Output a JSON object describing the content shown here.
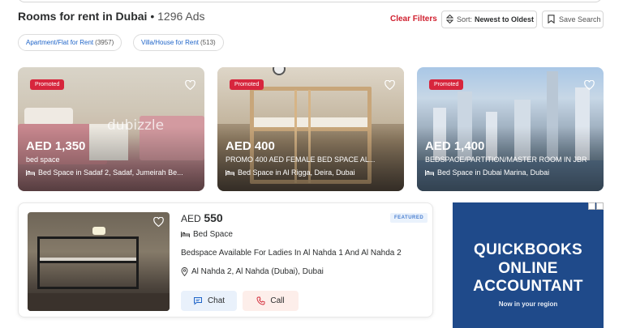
{
  "header": {
    "title": "Rooms for rent in Dubai",
    "separator": " • ",
    "ad_count": "1296 Ads",
    "clear_filters": "Clear Filters",
    "sort_prefix": "Sort:",
    "sort_value": "Newest to Oldest",
    "save_search": "Save Search"
  },
  "chips": [
    {
      "label": "Apartment/Flat for Rent",
      "count": "(3957)"
    },
    {
      "label": "Villa/House for Rent",
      "count": "(513)"
    }
  ],
  "promoted_cards": [
    {
      "badge": "Promoted",
      "currency": "AED",
      "price": "1,350",
      "subtitle": "bed space",
      "location": "Bed Space in Sadaf 2, Sadaf, Jumeirah Be...",
      "watermark": "dubizzle"
    },
    {
      "badge": "Promoted",
      "currency": "AED",
      "price": "400",
      "subtitle": "PROMO 400 AED FEMALE BED SPACE AL...",
      "location": "Bed Space in Al Rigga, Deira, Dubai"
    },
    {
      "badge": "Promoted",
      "currency": "AED",
      "price": "1,400",
      "subtitle": "BEDSPACE/PARTITION/MASTER ROOM IN JBR",
      "location": "Bed Space in Dubai Marina, Dubai"
    }
  ],
  "listing": {
    "currency": "AED",
    "price": "550",
    "badge": "FEATURED",
    "category": "Bed Space",
    "description": "Bedspace Available For Ladies In Al Nahda 1 And Al Nahda 2",
    "location": "Al Nahda 2, Al Nahda (Dubai), Dubai",
    "chat_label": "Chat",
    "call_label": "Call"
  },
  "ad": {
    "line1": "QUICKBOOKS",
    "line2": "ONLINE",
    "line3": "ACCOUNTANT",
    "sub": "Now in your region"
  },
  "colors": {
    "accent_red": "#d0202f",
    "link_blue": "#1e64c8",
    "promoted_badge": "#d7263d",
    "ad_background": "#1f4a8a"
  },
  "icons": [
    "sort-icon",
    "bookmark-icon",
    "heart-icon",
    "bed-icon",
    "location-pin-icon",
    "chat-icon",
    "phone-icon",
    "close-icon"
  ]
}
